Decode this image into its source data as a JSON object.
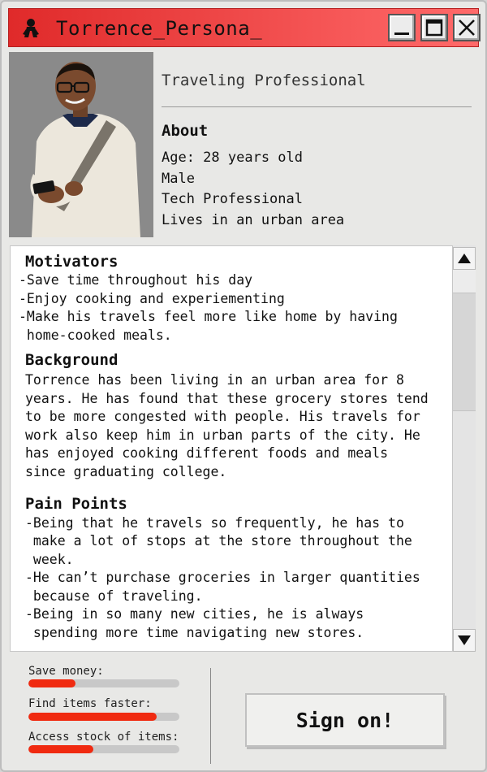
{
  "window": {
    "title": "Torrence_Persona_",
    "titlebar_gradient": [
      "#e02a2a",
      "#ff6a6a"
    ],
    "controls": [
      "minimize-icon",
      "maximize-icon",
      "close-icon"
    ]
  },
  "profile": {
    "photo_alt": "Persona photo",
    "subtitle": "Traveling Professional",
    "about_heading": "About",
    "about_items": [
      "Age: 28 years old",
      "Male",
      "Tech Professional",
      "Lives in an urban area"
    ]
  },
  "sections": {
    "motivators": {
      "heading": "Motivators",
      "lines": [
        "-Save time throughout his day",
        "-Enjoy cooking and experiementing",
        "-Make his travels feel more like home by having",
        " home-cooked meals."
      ]
    },
    "background": {
      "heading": "Background",
      "lines": [
        "Torrence has been living in an urban area for 8",
        "years. He has found that these grocery stores tend",
        "to be more congested with people. His travels for",
        "work also keep him in urban parts of the city. He",
        "has enjoyed cooking different foods and meals",
        "since graduating college."
      ]
    },
    "pain_points": {
      "heading": "Pain Points",
      "lines": [
        "-Being that he travels so frequently, he has to",
        " make a lot of stops at the store throughout the",
        " week.",
        "-He can’t purchase groceries in larger quantities",
        " because of traveling.",
        "-Being in so many new cities, he is always",
        " spending more time navigating new stores."
      ]
    }
  },
  "goals": [
    {
      "label": "Save money:",
      "level": 0.31
    },
    {
      "label": "Find items faster:",
      "level": 0.85
    },
    {
      "label": "Access stock of items:",
      "level": 0.43
    }
  ],
  "accent_color": "#f02a10",
  "cta": {
    "label": "Sign on!"
  }
}
